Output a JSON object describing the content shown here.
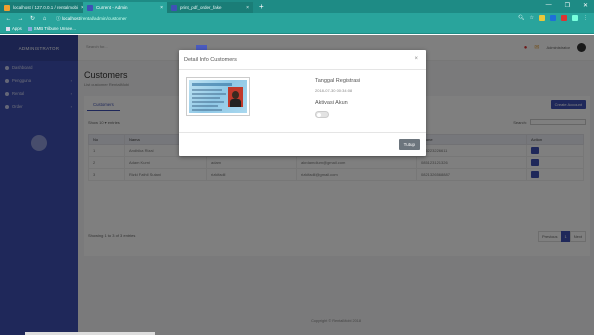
{
  "browser": {
    "tabs": [
      {
        "label": "localhost / 127.0.0.1 / rentalmobi",
        "color": "#f0a030"
      },
      {
        "label": "Current - Admin",
        "color": "#3f51b5"
      },
      {
        "label": "print_pdf_order_fake",
        "color": "#3f51b5"
      }
    ],
    "url_host": "localhost",
    "url_path": "/rental/admin/customer",
    "bookmarks": [
      "Apps",
      "SMB Tribune Unsee..."
    ],
    "new_tab_symbol": "+",
    "win_controls": [
      "—",
      "❐",
      "✕"
    ]
  },
  "sidebar": {
    "brand": "ADMINISTRATOR",
    "items": [
      {
        "label": "Dashboard"
      },
      {
        "label": "Pengguna"
      },
      {
        "label": "Rental"
      },
      {
        "label": "Order"
      }
    ]
  },
  "topbar": {
    "search_placeholder": "Search for...",
    "user": "Administrator"
  },
  "main": {
    "title": "Customers",
    "subtitle": "List customer RentalMobi",
    "tab": "Customers",
    "create_button": "Create Account",
    "show_entries": "Show 10 ▾ entries",
    "search_label": "Search:",
    "columns": [
      "No",
      "Nama",
      "Username",
      "Email",
      "Phone",
      "Action"
    ],
    "rows": [
      [
        "1",
        "Andhika Rizal",
        "user123",
        "rizal123_1986@gmail.com",
        "085223226611"
      ],
      [
        "2",
        "Adam Kurni",
        "adam",
        "akrdamdium@gmail.com",
        "085123121326"
      ],
      [
        "3",
        "Rizki Fathil Sutani",
        "rizkifadil",
        "rizkifadil@gmail.com",
        "0821326568887"
      ]
    ],
    "showing": "Showing 1 to 3 of 3 entries",
    "pager": [
      "Previous",
      "1",
      "Next"
    ],
    "footer": "Copyright © RentalMobi 2018"
  },
  "modal": {
    "title": "Detail Info Customers",
    "close_symbol": "×",
    "registered_label": "Tanggal Registrasi",
    "registered_value": "2018-07-30 00:34:08",
    "activation_label": "Aktivasi Akun",
    "activation_on": false,
    "close_button": "Tutup"
  }
}
